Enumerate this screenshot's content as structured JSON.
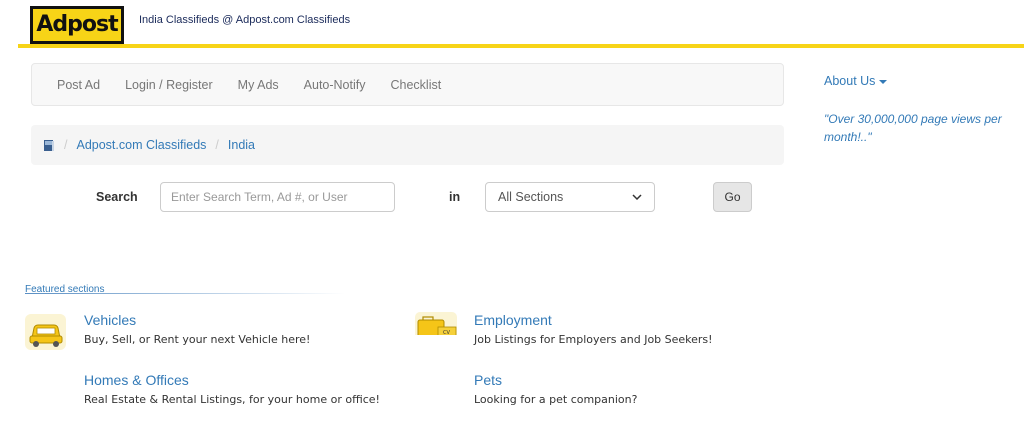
{
  "header": {
    "logo_text": "Adpost",
    "site_title": "India Classifieds @ Adpost.com Classifieds",
    "accent_color": "#f7d417"
  },
  "nav": {
    "items": [
      "Post Ad",
      "Login / Register",
      "My Ads",
      "Auto-Notify",
      "Checklist"
    ]
  },
  "breadcrumb": {
    "home_icon": "book-icon",
    "items": [
      "Adpost.com Classifieds",
      "India"
    ]
  },
  "search": {
    "label": "Search",
    "placeholder": "Enter Search Term, Ad #, or User",
    "in_label": "in",
    "section_selected": "All Sections",
    "go_label": "Go"
  },
  "sidebar": {
    "about_label": "About Us",
    "quote": "\"Over 30,000,000 page views per month!..\""
  },
  "featured": {
    "label": "Featured sections",
    "sections": [
      {
        "title": "Vehicles",
        "desc": "Buy, Sell, or Rent your next Vehicle here!",
        "icon": "car-icon"
      },
      {
        "title": "Employment",
        "desc": "Job Listings for Employers and Job Seekers!",
        "icon": "briefcase-icon"
      },
      {
        "title": "Homes & Offices",
        "desc": "Real Estate & Rental Listings, for your home or office!"
      },
      {
        "title": "Pets",
        "desc": "Looking for a pet companion?"
      }
    ]
  }
}
